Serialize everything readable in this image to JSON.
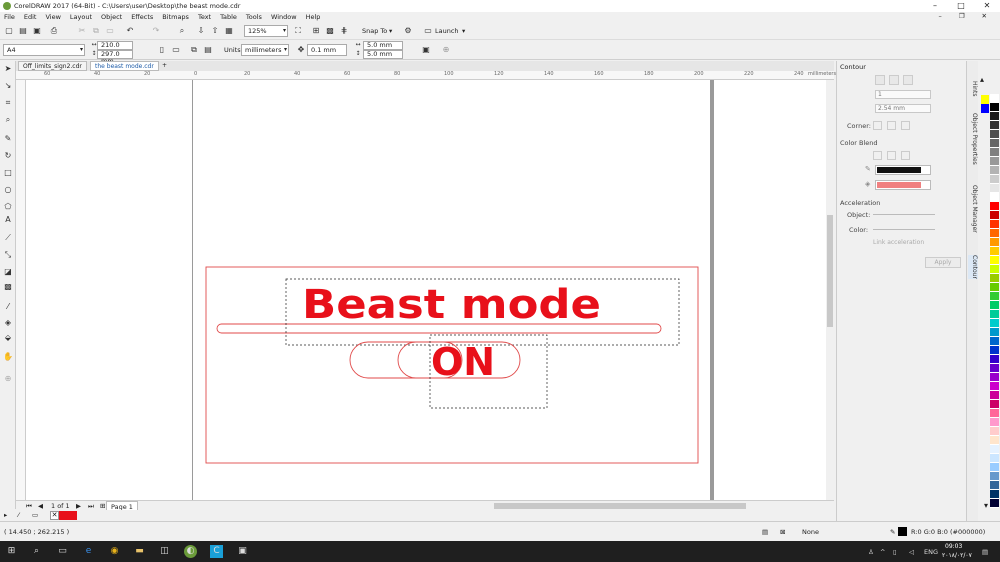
{
  "window": {
    "title": "CorelDRAW 2017 (64-Bit) - C:\\Users\\user\\Desktop\\the beast mode.cdr",
    "controls": [
      "–",
      "□",
      "✕"
    ]
  },
  "menu": {
    "items": [
      "File",
      "Edit",
      "View",
      "Layout",
      "Object",
      "Effects",
      "Bitmaps",
      "Text",
      "Table",
      "Tools",
      "Window",
      "Help"
    ]
  },
  "toolbar": {
    "zoom": "125%",
    "snap_to": "Snap To",
    "launch": "Launch"
  },
  "propbar": {
    "page_size": "A4",
    "width": "210.0 mm",
    "height": "297.0 mm",
    "units_label": "Units:",
    "units": "millimeters",
    "nudge": "0.1 mm",
    "dup_x": "5.0 mm",
    "dup_y": "5.0 mm"
  },
  "tabs": [
    "Off_limits_sign2.cdr",
    "the beast mode.cdr",
    "+"
  ],
  "ruler": {
    "h_ticks": [
      "60",
      "40",
      "20",
      "0",
      "20",
      "40",
      "60",
      "80",
      "100",
      "120",
      "140",
      "160",
      "180",
      "200",
      "220",
      "240"
    ],
    "unit": "millimeters"
  },
  "artwork": {
    "title": "Beast mode",
    "toggle_text": "ON",
    "colors": {
      "red": "#e8101a",
      "outline": "#e04a4a"
    }
  },
  "page_nav": {
    "counter": "1 of 1",
    "page_tab": "Page 1"
  },
  "docker": {
    "title": "Contour",
    "steps": "1",
    "offset": "2.54 mm",
    "corner_label": "Corner:",
    "color_blend_label": "Color Blend",
    "outline_color": "#111111",
    "fill_color": "#f08080",
    "acceleration_label": "Acceleration",
    "object_label": "Object:",
    "color_label": "Color:",
    "link_label": "Link acceleration",
    "apply_label": "Apply"
  },
  "docker_tabs": [
    "Hints",
    "Object Properties",
    "Object Manager",
    "Contour"
  ],
  "palette_colors": [
    "#ffffff",
    "#000000",
    "#1a1a1a",
    "#333333",
    "#4d4d4d",
    "#666666",
    "#808080",
    "#999999",
    "#b3b3b3",
    "#cccccc",
    "#e6e6e6",
    "#ffffff",
    "#ff0000",
    "#cc0000",
    "#ff3300",
    "#ff6600",
    "#ff9900",
    "#ffcc00",
    "#ffff00",
    "#ccff00",
    "#99cc00",
    "#66cc00",
    "#33cc33",
    "#00cc66",
    "#00cc99",
    "#00cccc",
    "#0099cc",
    "#0066cc",
    "#0033cc",
    "#3300cc",
    "#6600cc",
    "#9900cc",
    "#cc00cc",
    "#cc0099",
    "#cc0066",
    "#ff6699",
    "#ff99cc",
    "#ffcccc",
    "#ffe5cc",
    "#e6f2ff",
    "#cce6ff",
    "#99ccff",
    "#6699cc",
    "#336699",
    "#003366",
    "#000033"
  ],
  "palette_top": [
    "#ff0000",
    "#ffff00",
    "#0000ff"
  ],
  "status": {
    "coords": "( 14.450 ; 262.215 )",
    "fill_none": "None",
    "color_info": "R:0 G:0 B:0 (#000000)"
  },
  "taskbar": {
    "lang": "ENG",
    "time": "09:03 ",
    "date": "٢٠١٨/٠٢/٠٧"
  }
}
